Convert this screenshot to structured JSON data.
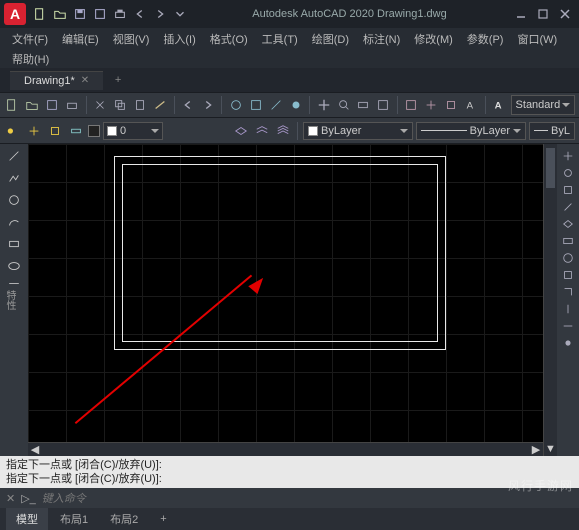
{
  "title": "Autodesk AutoCAD 2020   Drawing1.dwg",
  "menu": {
    "file": "文件(F)",
    "edit": "编辑(E)",
    "view": "视图(V)",
    "insert": "插入(I)",
    "format": "格式(O)",
    "tools": "工具(T)",
    "draw": "绘图(D)",
    "dimension": "标注(N)",
    "modify": "修改(M)",
    "param": "参数(P)",
    "window": "窗口(W)",
    "help": "帮助(H)"
  },
  "file_tab": "Drawing1*",
  "style_dropdown": "Standard",
  "layer_dropdown": "0",
  "bylayer1": "ByLayer",
  "bylayer2": "ByLayer",
  "bylayer3": "ByL",
  "side_label": "特性",
  "cmd": {
    "line1": "指定下一点或 [闭合(C)/放弃(U)]:",
    "line2": "指定下一点或 [闭合(C)/放弃(U)]:",
    "placeholder": "键入命令"
  },
  "tabs": {
    "model": "模型",
    "layout1": "布局1",
    "layout2": "布局2"
  },
  "watermark": "风行手游网"
}
